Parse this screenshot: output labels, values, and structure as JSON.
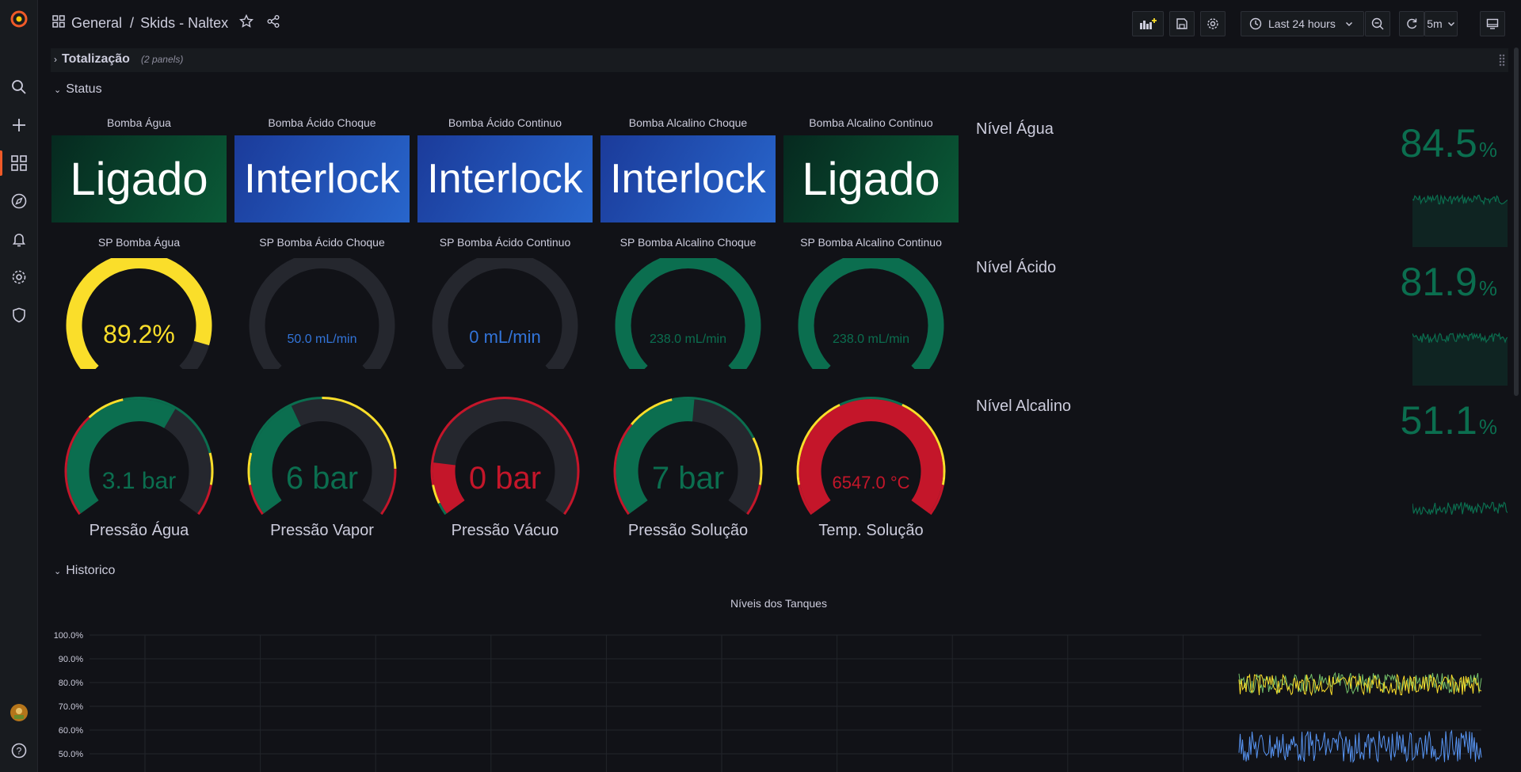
{
  "breadcrumb": {
    "folder": "General",
    "separator": "/",
    "dashboard": "Skids - Naltex"
  },
  "toolbar": {
    "time_range": "Last 24 hours",
    "refresh": "5m"
  },
  "rows": {
    "totalizacao": {
      "title": "Totalização",
      "note": "(2 panels)"
    },
    "status": {
      "title": "Status"
    },
    "historico": {
      "title": "Historico"
    }
  },
  "status_panels": [
    {
      "title": "Bomba Água",
      "value": "Ligado",
      "color": "green"
    },
    {
      "title": "Bomba Ácido Choque",
      "value": "Interlock",
      "color": "blue"
    },
    {
      "title": "Bomba Ácido Continuo",
      "value": "Interlock",
      "color": "blue"
    },
    {
      "title": "Bomba Alcalino Choque",
      "value": "Interlock",
      "color": "blue"
    },
    {
      "title": "Bomba Alcalino Continuo",
      "value": "Ligado",
      "color": "green"
    }
  ],
  "sp_gauges": [
    {
      "title": "SP Bomba Água",
      "value_text": "89.2%",
      "fraction": 0.892,
      "color": "#fade2a"
    },
    {
      "title": "SP Bomba Ácido Choque",
      "value_text": "50.0 mL/min",
      "fraction": 0,
      "color": "#3274d9"
    },
    {
      "title": "SP Bomba Ácido Continuo",
      "value_text": "0 mL/min",
      "fraction": 0,
      "color": "#3274d9"
    },
    {
      "title": "SP Bomba Alcalino Choque",
      "value_text": "238.0 mL/min",
      "fraction": 1,
      "color": "#0b6e4f"
    },
    {
      "title": "SP Bomba Alcalino Continuo",
      "value_text": "238.0 mL/min",
      "fraction": 1,
      "color": "#0b6e4f"
    }
  ],
  "pressure_gauges": [
    {
      "label": "Pressão Água",
      "value_text": "3.1 bar",
      "fraction": 0.62,
      "color": "#0b6e4f"
    },
    {
      "label": "Pressão Vapor",
      "value_text": "6 bar",
      "fraction": 0.4,
      "color": "#0b6e4f"
    },
    {
      "label": "Pressão Vácuo",
      "value_text": "0 bar",
      "fraction": 0.17,
      "color": "#c4162a"
    },
    {
      "label": "Pressão Solução",
      "value_text": "7 bar",
      "fraction": 0.52,
      "color": "#0b6e4f"
    },
    {
      "label": "Temp. Solução",
      "value_text": "6547.0 °C",
      "fraction": 1,
      "color": "#c4162a"
    }
  ],
  "levels": [
    {
      "name": "Nível Água",
      "value": "84.5",
      "unit": "%"
    },
    {
      "name": "Nível Ácido",
      "value": "81.9",
      "unit": "%"
    },
    {
      "name": "Nível Alcalino",
      "value": "51.1",
      "unit": "%"
    }
  ],
  "history_chart": {
    "title": "Níveis dos Tanques",
    "y_ticks": [
      "100.0%",
      "90.0%",
      "80.0%",
      "70.0%",
      "60.0%",
      "50.0%"
    ]
  },
  "colors": {
    "green": "#0b6e4f",
    "yellow": "#fade2a",
    "red": "#c4162a",
    "blue": "#3274d9",
    "accent": "#f05a28"
  }
}
